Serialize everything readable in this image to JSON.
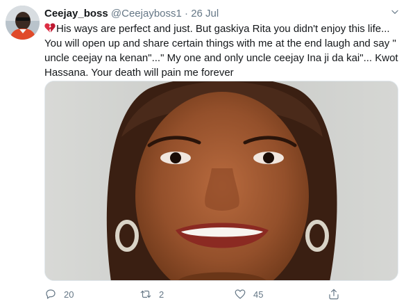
{
  "tweet": {
    "display_name": "Ceejay_boss",
    "handle": "@Ceejayboss1",
    "separator": "·",
    "time": "26 Jul",
    "text_lines": [
      "His ways are perfect and just. But gaskiya Rita you didn't enjoy this life...",
      "You will open up and share certain things with me at the end laugh and say \"",
      "uncle ceejay na kenan\"...\" My one and only uncle ceejay Ina ji da kai\"... Kwot...",
      "Hassana. Your death will pain me forever"
    ],
    "emoji": "broken-heart",
    "replies": "20",
    "retweets": "2",
    "likes": "45"
  },
  "icons": {
    "reply": "reply-icon",
    "retweet": "retweet-icon",
    "like": "like-icon",
    "share": "share-icon",
    "more": "chevron-down-icon"
  },
  "colors": {
    "text": "#14171a",
    "secondary": "#657786",
    "emoji_red": "#dd2e44"
  }
}
